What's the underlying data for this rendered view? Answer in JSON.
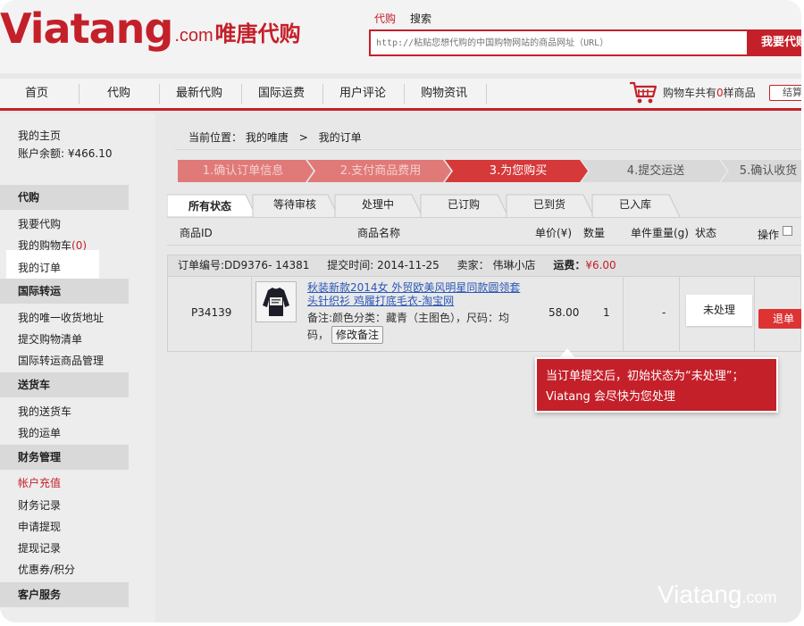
{
  "header": {
    "logo_main": "Viatang",
    "logo_com": ".com",
    "logo_cn": "唯唐代购",
    "search_tabs": [
      "代购",
      "搜索"
    ],
    "search_placeholder": "http://粘贴您想代购的中国购物网站的商品网址（URL）",
    "search_button": "我要代购"
  },
  "nav": {
    "items": [
      "首页",
      "代购",
      "最新代购",
      "国际运费",
      "用户评论",
      "购物资讯"
    ],
    "cart_prefix": "购物车共有",
    "cart_count": "0",
    "cart_suffix": "样商品",
    "checkout": "结算",
    "cart_icon": "shopping-cart-icon"
  },
  "sidebar": {
    "home": "我的主页",
    "balance": "账户余额: ¥466.10",
    "sections": [
      {
        "title": "代购",
        "items": [
          {
            "label": "我要代购"
          },
          {
            "label": "我的购物车",
            "badge": "(0)"
          },
          {
            "label": "我的订单"
          }
        ]
      },
      {
        "title": "国际转运",
        "items": [
          {
            "label": "我的唯一收货地址"
          },
          {
            "label": "提交购物清单"
          },
          {
            "label": "国际转运商品管理"
          }
        ]
      },
      {
        "title": "送货车",
        "items": [
          {
            "label": "我的送货车"
          },
          {
            "label": "我的运单"
          }
        ]
      },
      {
        "title": "财务管理",
        "items": [
          {
            "label": "帐户充值"
          },
          {
            "label": "财务记录"
          },
          {
            "label": "申请提现"
          },
          {
            "label": "提现记录"
          },
          {
            "label": "优惠券/积分"
          }
        ]
      },
      {
        "title": "客户服务",
        "items": []
      }
    ]
  },
  "main": {
    "breadcrumb_label": "当前位置：",
    "breadcrumb": [
      "我的唯唐",
      "我的订单"
    ],
    "breadcrumb_sep": ">",
    "steps": [
      "1.确认订单信息",
      "2.支付商品费用",
      "3.为您购买",
      "4.提交运送",
      "5.确认收货"
    ],
    "active_step": 3,
    "tabs": [
      "所有状态",
      "等待审核",
      "处理中",
      "已订购",
      "已到货",
      "已入库"
    ],
    "table_headers": {
      "id": "商品ID",
      "name": "商品名称",
      "price": "单价(¥)",
      "qty": "数量",
      "weight": "单件重量(g)",
      "status": "状态",
      "action": "操作"
    },
    "order": {
      "number": "订单编号:DD9376- 14381",
      "time": "提交时间: 2014-11-25",
      "seller": "卖家：  伟琳小店",
      "shipping_label": "运费：",
      "shipping_value": "¥6.00",
      "item": {
        "id": "P34139",
        "title": "秋装新款2014女 外贸欧美风明星同款圆领套头针织衫 鸡履打底毛衣-淘宝网",
        "note": "备注:颜色分类：藏青（主图色），尺码：均码，",
        "edit_note": "修改备注",
        "price": "58.00",
        "qty": "1",
        "weight": "-",
        "status": "未处理",
        "refund": "退单"
      }
    }
  },
  "callout": {
    "line1": "当订单提交后，初始状态为“未处理”；",
    "line2": "Viatang 会尽快为您处理"
  },
  "watermark": {
    "main": "Viatang",
    "suffix": ".com"
  },
  "colors": {
    "brand": "#c4202a",
    "link": "#2a56b6",
    "step_pending": "#d9d9d9"
  }
}
